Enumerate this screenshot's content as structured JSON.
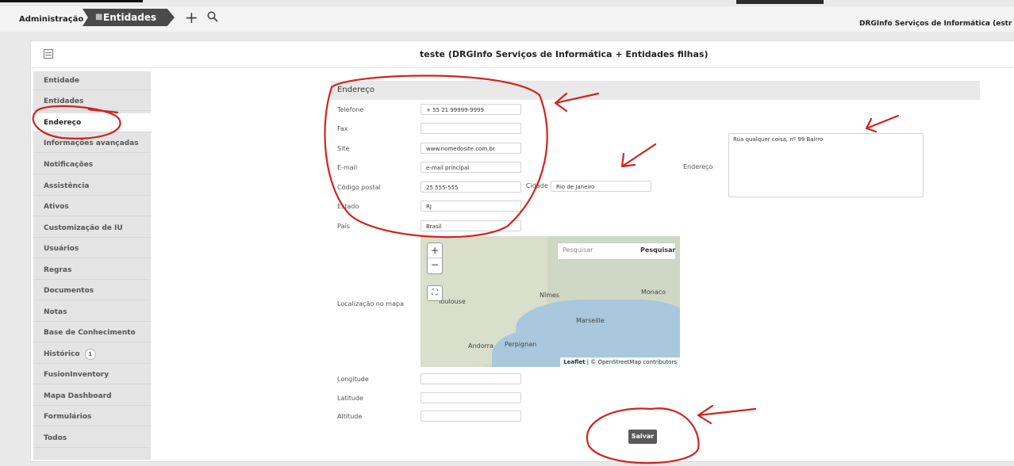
{
  "topbar": {
    "admin": "Administração",
    "entidades": "Entidades",
    "entity_name": "DRGInfo Serviços de Informática (estr"
  },
  "page": {
    "title": "teste (DRGInfo Serviços de Informática + Entidades filhas)"
  },
  "sidebar": {
    "items": [
      {
        "label": "Entidade"
      },
      {
        "label": "Entidades"
      },
      {
        "label": "Endereço"
      },
      {
        "label": "Informações avançadas"
      },
      {
        "label": "Notificações"
      },
      {
        "label": "Assistência"
      },
      {
        "label": "Ativos"
      },
      {
        "label": "Customização de IU"
      },
      {
        "label": "Usuários"
      },
      {
        "label": "Regras"
      },
      {
        "label": "Documentos"
      },
      {
        "label": "Notas"
      },
      {
        "label": "Base de Conhecimento"
      },
      {
        "label": "Histórico",
        "badge": "1"
      },
      {
        "label": "FusionInventory"
      },
      {
        "label": "Mapa Dashboard"
      },
      {
        "label": "Formulários"
      },
      {
        "label": "Todos"
      }
    ]
  },
  "form": {
    "section": "Endereço",
    "telefone_label": "Telefone",
    "telefone_value": "+ 55 21 99999-9999",
    "fax_label": "Fax",
    "fax_value": "",
    "site_label": "Site",
    "site_value": "www.nomedosite.com.br",
    "email_label": "E-mail",
    "email_value": "e-mail principal",
    "cep_label": "Código postal",
    "cep_value": "25.555-555",
    "cidade_label": "Cidade",
    "cidade_value": "Rio de Janeiro",
    "estado_label": "Estado",
    "estado_value": "RJ",
    "pais_label": "País",
    "pais_value": "Brasil",
    "endereco_label": "Endereço",
    "endereco_value": "Rua qualquer coisa, nº 99 Bairro",
    "mapa_label": "Localização no mapa",
    "longitude_label": "Longitude",
    "latitude_label": "Latitude",
    "altitude_label": "Altitude",
    "save_label": "Salvar"
  },
  "map": {
    "search_placeholder": "Pesquisar",
    "search_button": "Pesquisar",
    "zoom_in": "+",
    "zoom_out": "−",
    "cities": [
      "Toulouse",
      "Nîmes",
      "Marseille",
      "Monaco",
      "Perpignan",
      "Andorra"
    ],
    "attribution_leaflet": "Leaflet",
    "attribution_rest": " | © OpenStreetMap contributors"
  },
  "colors": {
    "annotation": "#d22222",
    "active_bg": "#ffffff",
    "sidebar_bg": "#e4e4e4",
    "breadcrumb_bg": "#4a4a4a"
  }
}
